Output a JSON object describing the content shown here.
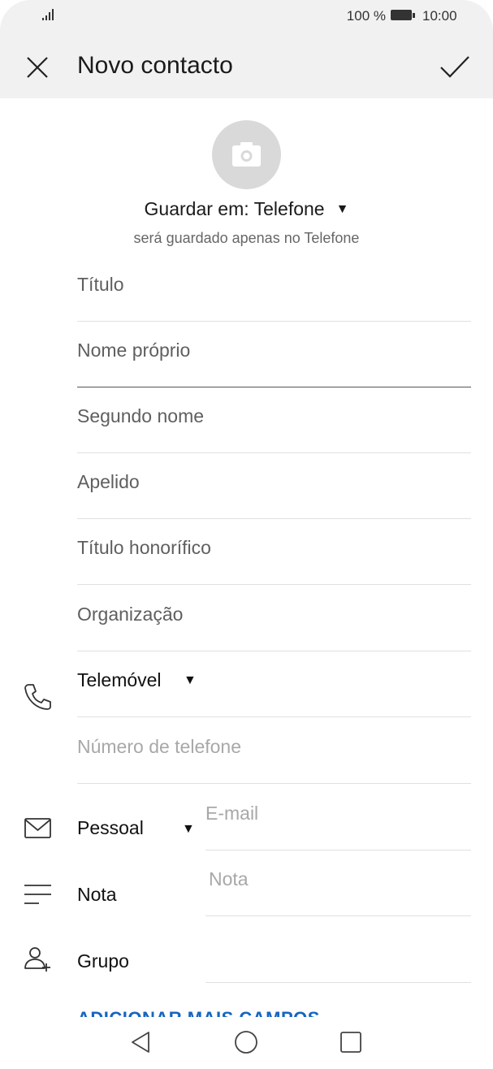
{
  "status_bar": {
    "battery": "100 %",
    "time": "10:00"
  },
  "header": {
    "title": "Novo contacto"
  },
  "storage": {
    "label": "Guardar em: Telefone",
    "note": "será guardado apenas no Telefone"
  },
  "fields": {
    "titulo": "Título",
    "nome_proprio": "Nome próprio",
    "segundo_nome": "Segundo nome",
    "apelido": "Apelido",
    "titulo_honorifico": "Título honorífico",
    "organizacao": "Organização"
  },
  "phone": {
    "type": "Telemóvel",
    "placeholder": "Número de telefone"
  },
  "email": {
    "type": "Pessoal",
    "placeholder": "E-mail"
  },
  "note": {
    "label": "Nota",
    "placeholder": "Nota"
  },
  "group": {
    "label": "Grupo"
  },
  "more_fields": "ADICIONAR MAIS CAMPOS",
  "icons": [
    "signal-icon",
    "battery-icon",
    "close-icon",
    "check-icon",
    "camera-icon",
    "dropdown-arrow-icon",
    "phone-icon",
    "mail-icon",
    "note-icon",
    "group-icon",
    "nav-back-icon",
    "nav-home-icon",
    "nav-recents-icon"
  ]
}
